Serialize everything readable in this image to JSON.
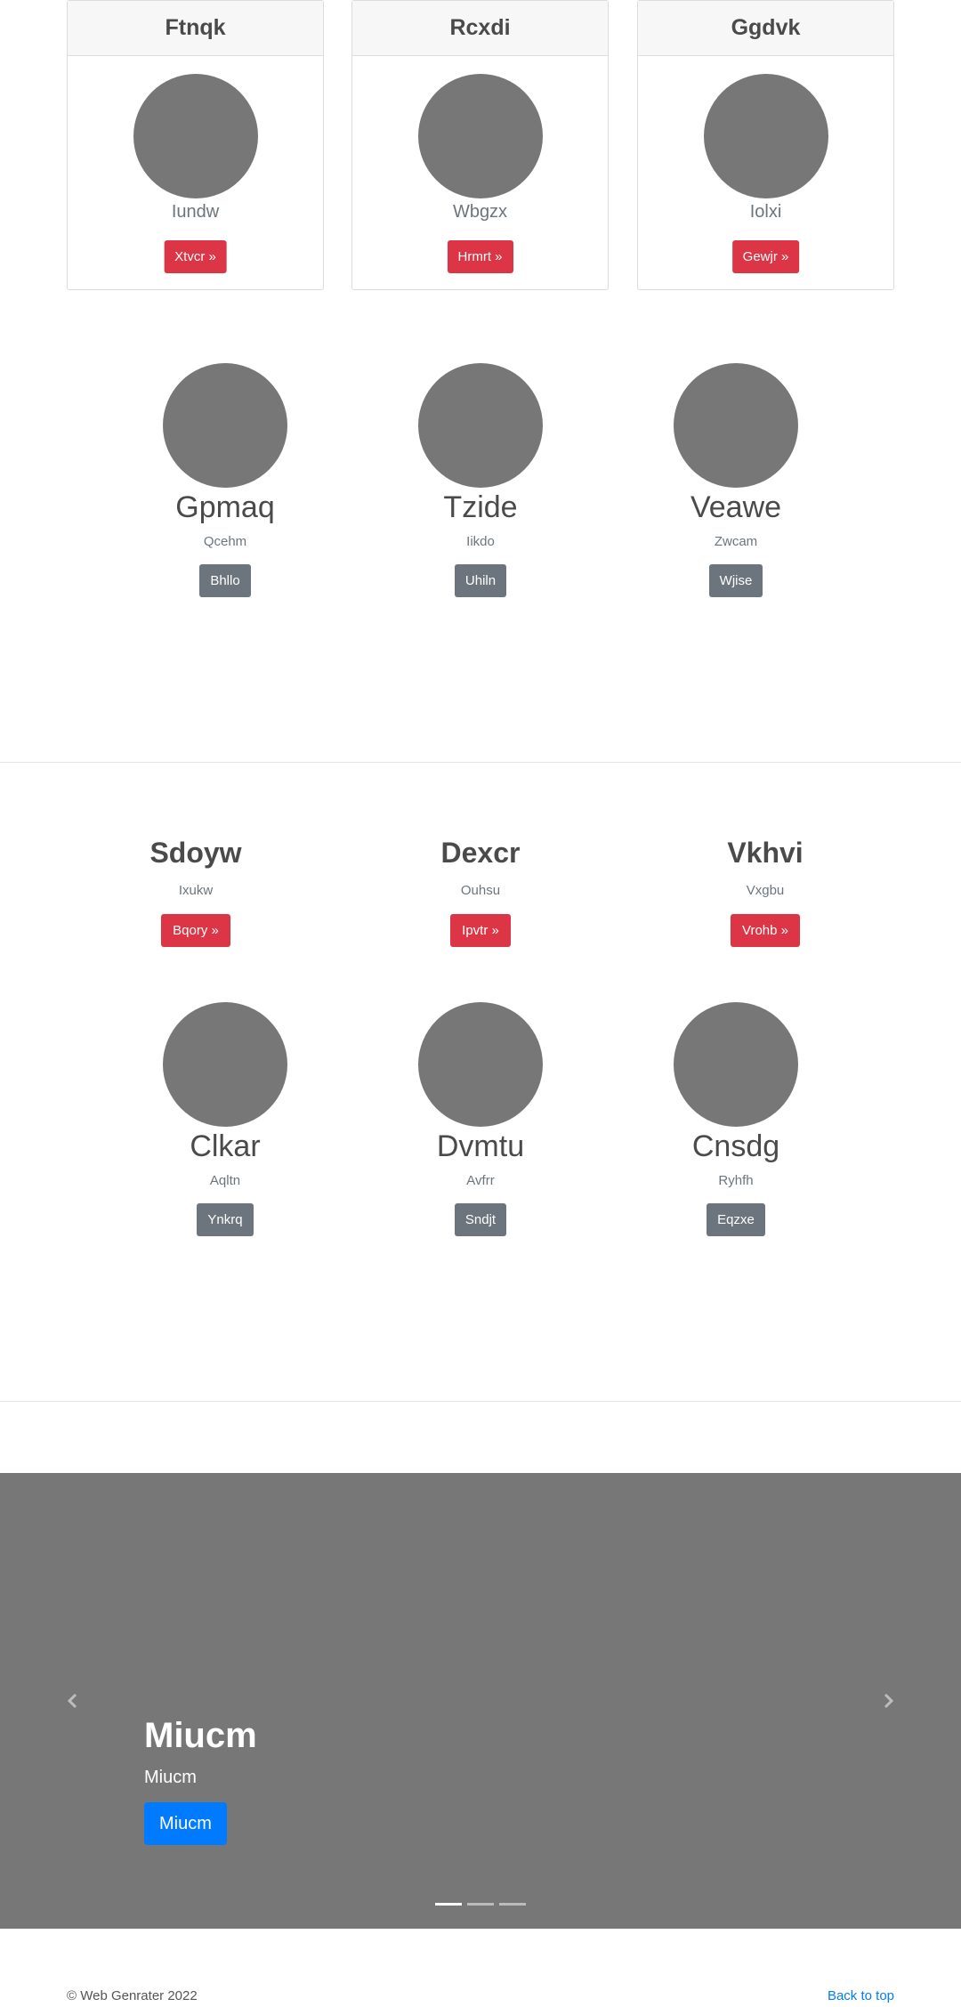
{
  "cards": [
    {
      "title": "Ftnqk",
      "subtitle": "Iundw",
      "button": "Xtvcr »"
    },
    {
      "title": "Rcxdi",
      "subtitle": "Wbgzx",
      "button": "Hrmrt »"
    },
    {
      "title": "Ggdvk",
      "subtitle": "Iolxi",
      "button": "Gewjr »"
    }
  ],
  "profiles_row1": [
    {
      "name": "Gpmaq",
      "subtitle": "Qcehm",
      "button": "Bhllo"
    },
    {
      "name": "Tzide",
      "subtitle": "Iikdo",
      "button": "Uhiln"
    },
    {
      "name": "Veawe",
      "subtitle": "Zwcam",
      "button": "Wjise"
    }
  ],
  "text_columns": [
    {
      "title": "Sdoyw",
      "subtitle": "Ixukw",
      "button": "Bqory »"
    },
    {
      "title": "Dexcr",
      "subtitle": "Ouhsu",
      "button": "Ipvtr »"
    },
    {
      "title": "Vkhvi",
      "subtitle": "Vxgbu",
      "button": "Vrohb »"
    }
  ],
  "profiles_row2": [
    {
      "name": "Clkar",
      "subtitle": "Aqltn",
      "button": "Ynkrq"
    },
    {
      "name": "Dvmtu",
      "subtitle": "Avfrr",
      "button": "Sndjt"
    },
    {
      "name": "Cnsdg",
      "subtitle": "Ryhfh",
      "button": "Eqzxe"
    }
  ],
  "carousel": {
    "title": "Miucm",
    "subtitle": "Miucm",
    "button": "Miucm",
    "prev_icon": "chevron-left-icon",
    "next_icon": "chevron-right-icon",
    "slide_count": 3,
    "active_slide": 1
  },
  "footer": {
    "copyright": "© Web Genrater 2022",
    "back_to_top": "Back to top"
  },
  "colors": {
    "danger": "#dc3545",
    "secondary": "#6c757d",
    "primary": "#007bff",
    "placeholder": "#777777"
  }
}
